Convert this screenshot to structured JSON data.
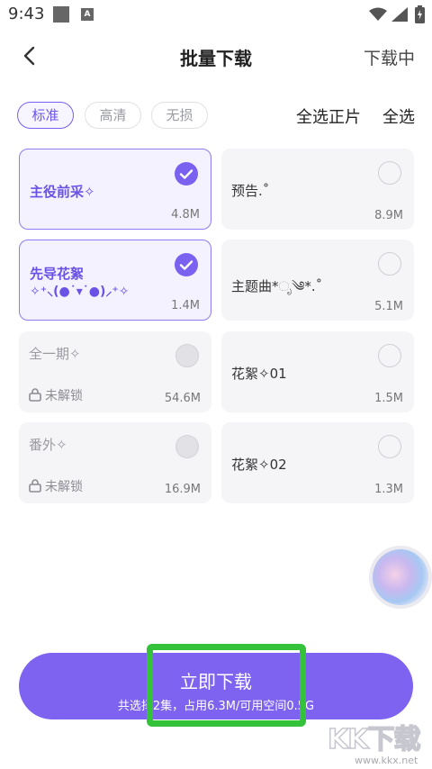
{
  "status_bar": {
    "time": "9:43",
    "a_glyph": "A"
  },
  "header": {
    "title": "批量下载",
    "downloading": "下载中"
  },
  "quality_tabs": [
    {
      "label": "标准",
      "active": true
    },
    {
      "label": "高清",
      "active": false
    },
    {
      "label": "无损",
      "active": false
    }
  ],
  "select_main": "全选正片",
  "select_all": "全选",
  "items": [
    {
      "title": "主役前采✧",
      "sub": "",
      "size": "4.8M",
      "state": "selected"
    },
    {
      "title": "预告.˚",
      "sub": "",
      "size": "8.9M",
      "state": "unselected"
    },
    {
      "title": "先导花絮",
      "sub": "✧⁺⸜(●˙▾˙●)⸝⁺✧",
      "size": "1.4M",
      "state": "selected"
    },
    {
      "title": "主题曲*ೃ༄*.˚",
      "sub": "",
      "size": "5.1M",
      "state": "unselected"
    },
    {
      "title": "全一期✧",
      "lock": "未解锁",
      "size": "54.6M",
      "state": "locked"
    },
    {
      "title": "花絮✧01",
      "sub": "",
      "size": "1.5M",
      "state": "unselected"
    },
    {
      "title": "番外✧",
      "lock": "未解锁",
      "size": "16.9M",
      "state": "locked"
    },
    {
      "title": "花絮✧02",
      "sub": "",
      "size": "1.3M",
      "state": "unselected"
    }
  ],
  "download_button": {
    "label": "立即下载",
    "info": "共选择2集，占用6.3M/可用空间0.5G"
  },
  "watermark": {
    "text": "KK下载",
    "url": "www.kkx.net"
  },
  "colors": {
    "accent": "#7d63f0",
    "highlight_box": "#34c23a"
  }
}
